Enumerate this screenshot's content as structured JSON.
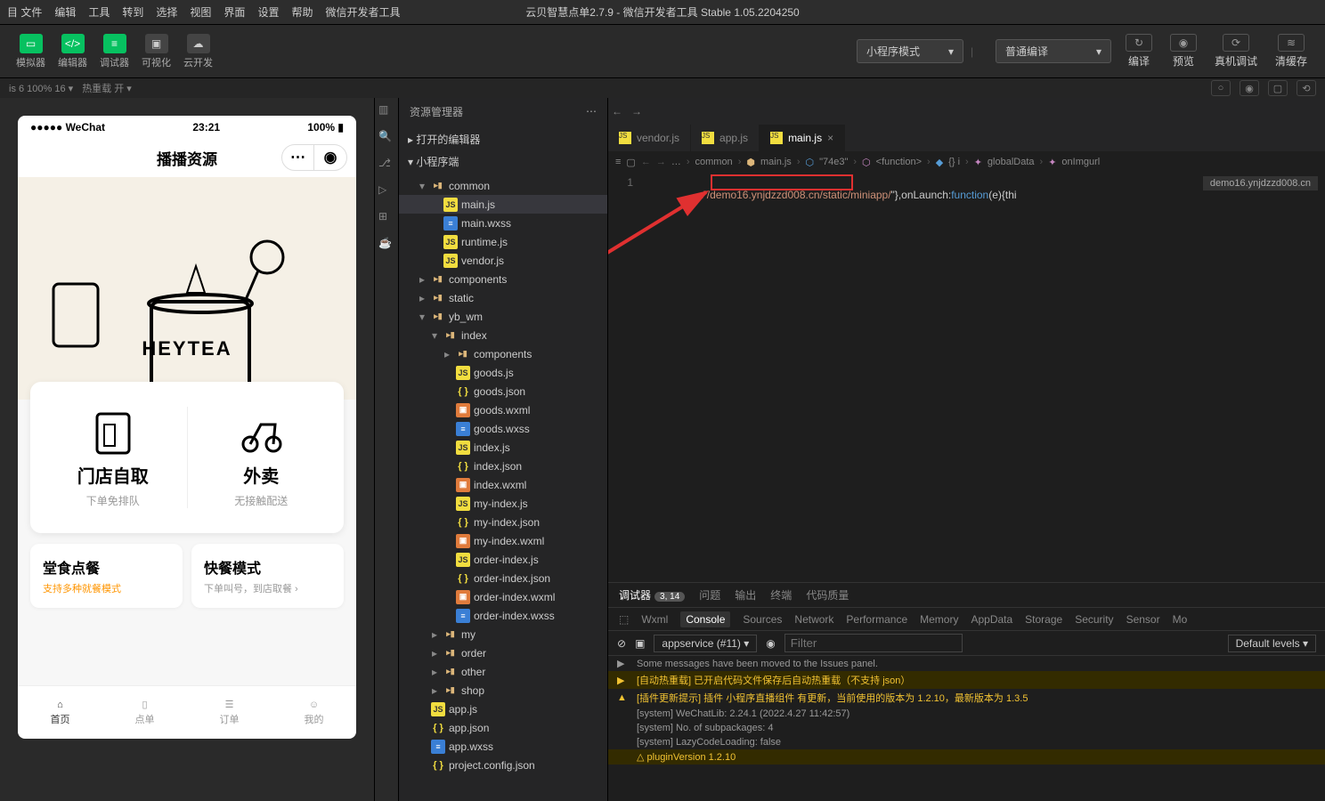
{
  "menu": {
    "items": [
      "目 文件",
      "编辑",
      "工具",
      "转到",
      "选择",
      "视图",
      "界面",
      "设置",
      "帮助",
      "微信开发者工具"
    ],
    "title": "云贝智慧点单2.7.9 - 微信开发者工具 Stable 1.05.2204250"
  },
  "toolbar": {
    "sim": "模拟器",
    "editor": "编辑器",
    "debugger": "调试器",
    "visual": "可视化",
    "cloud": "云开发",
    "mode": "小程序模式",
    "compile": "普通编译",
    "compile_btn": "编译",
    "preview": "预览",
    "remote": "真机调试",
    "clear": "清缓存"
  },
  "status": {
    "left": "is 6 100% 16 ▾",
    "hot": "热重载 开 ▾"
  },
  "phone": {
    "carrier": "●●●●● WeChat",
    "time": "23:21",
    "batt": "100%",
    "title": "播播资源",
    "c1t": "门店自取",
    "c1s": "下单免排队",
    "c2t": "外卖",
    "c2s": "无接触配送",
    "q1t": "堂食点餐",
    "q1s": "支持多种就餐模式",
    "q2t": "快餐模式",
    "q2s": "下单叫号，到店取餐",
    "tabs": [
      "首页",
      "点单",
      "订单",
      "我的"
    ],
    "brand": "HEYTEA"
  },
  "explorer": {
    "title": "资源管理器",
    "open": "打开的编辑器",
    "root": "小程序端",
    "tree": [
      {
        "d": 1,
        "t": "folder",
        "n": "common",
        "open": true
      },
      {
        "d": 2,
        "t": "js",
        "n": "main.js",
        "sel": true
      },
      {
        "d": 2,
        "t": "wxss",
        "n": "main.wxss"
      },
      {
        "d": 2,
        "t": "js",
        "n": "runtime.js"
      },
      {
        "d": 2,
        "t": "js",
        "n": "vendor.js"
      },
      {
        "d": 1,
        "t": "folder",
        "n": "components",
        "closed": true
      },
      {
        "d": 1,
        "t": "folder",
        "n": "static",
        "closed": true
      },
      {
        "d": 1,
        "t": "folder",
        "n": "yb_wm",
        "open": true
      },
      {
        "d": 2,
        "t": "folder",
        "n": "index",
        "open": true
      },
      {
        "d": 3,
        "t": "folder",
        "n": "components",
        "closed": true
      },
      {
        "d": 3,
        "t": "js",
        "n": "goods.js"
      },
      {
        "d": 3,
        "t": "json",
        "n": "goods.json"
      },
      {
        "d": 3,
        "t": "wxml",
        "n": "goods.wxml"
      },
      {
        "d": 3,
        "t": "wxss",
        "n": "goods.wxss"
      },
      {
        "d": 3,
        "t": "js",
        "n": "index.js"
      },
      {
        "d": 3,
        "t": "json",
        "n": "index.json"
      },
      {
        "d": 3,
        "t": "wxml",
        "n": "index.wxml"
      },
      {
        "d": 3,
        "t": "js",
        "n": "my-index.js"
      },
      {
        "d": 3,
        "t": "json",
        "n": "my-index.json"
      },
      {
        "d": 3,
        "t": "wxml",
        "n": "my-index.wxml"
      },
      {
        "d": 3,
        "t": "js",
        "n": "order-index.js"
      },
      {
        "d": 3,
        "t": "json",
        "n": "order-index.json"
      },
      {
        "d": 3,
        "t": "wxml",
        "n": "order-index.wxml"
      },
      {
        "d": 3,
        "t": "wxss",
        "n": "order-index.wxss"
      },
      {
        "d": 2,
        "t": "folder",
        "n": "my",
        "closed": true
      },
      {
        "d": 2,
        "t": "folder",
        "n": "order",
        "closed": true
      },
      {
        "d": 2,
        "t": "folder",
        "n": "other",
        "closed": true
      },
      {
        "d": 2,
        "t": "folder",
        "n": "shop",
        "closed": true
      },
      {
        "d": 1,
        "t": "js",
        "n": "app.js"
      },
      {
        "d": 1,
        "t": "json",
        "n": "app.json"
      },
      {
        "d": 1,
        "t": "wxss",
        "n": "app.wxss"
      },
      {
        "d": 1,
        "t": "json",
        "n": "project.config.json"
      }
    ]
  },
  "tabs": [
    {
      "n": "vendor.js",
      "ic": "js"
    },
    {
      "n": "app.js",
      "ic": "js"
    },
    {
      "n": "main.js",
      "ic": "js",
      "active": true
    }
  ],
  "breadcrumb": [
    "…",
    "common",
    "main.js",
    "\"74e3\"",
    "<function>",
    "{} i",
    "globalData",
    "onImgurl"
  ],
  "code": {
    "line": "1",
    "pre": ":/'/",
    "url": "demo16.ynjdzzd008.cn/",
    "path": "static/miniapp/",
    "rest": "\"},onLaunch:",
    "kw": "function",
    "rest2": "(e){thi",
    "hint": "demo16.ynjdzzd008.cn"
  },
  "dbg": {
    "tabs": [
      "调试器",
      "问题",
      "输出",
      "终端",
      "代码质量"
    ],
    "badge": "3, 14",
    "sub": [
      "Wxml",
      "Console",
      "Sources",
      "Network",
      "Performance",
      "Memory",
      "AppData",
      "Storage",
      "Security",
      "Sensor",
      "Mo"
    ],
    "ctx": "appservice (#11)",
    "filter": "Filter",
    "levels": "Default levels ▾",
    "lines": [
      {
        "c": "info",
        "t": "Some messages have been moved to the Issues panel.",
        "i": "▶"
      },
      {
        "c": "warn",
        "t": "[自动热重载] 已开启代码文件保存后自动热重载（不支持 json）",
        "i": "▶"
      },
      {
        "c": "warn2",
        "t": "[插件更新提示] 插件 小程序直播组件 有更新，当前使用的版本为 1.2.10，最新版本为 1.3.5",
        "i": "▲"
      },
      {
        "c": "info",
        "t": "[system] WeChatLib: 2.24.1 (2022.4.27 11:42:57)"
      },
      {
        "c": "info",
        "t": "[system] No. of subpackages: 4"
      },
      {
        "c": "info",
        "t": "[system] LazyCodeLoading: false"
      },
      {
        "c": "warn",
        "t": "△ pluginVersion 1.2.10"
      }
    ]
  }
}
